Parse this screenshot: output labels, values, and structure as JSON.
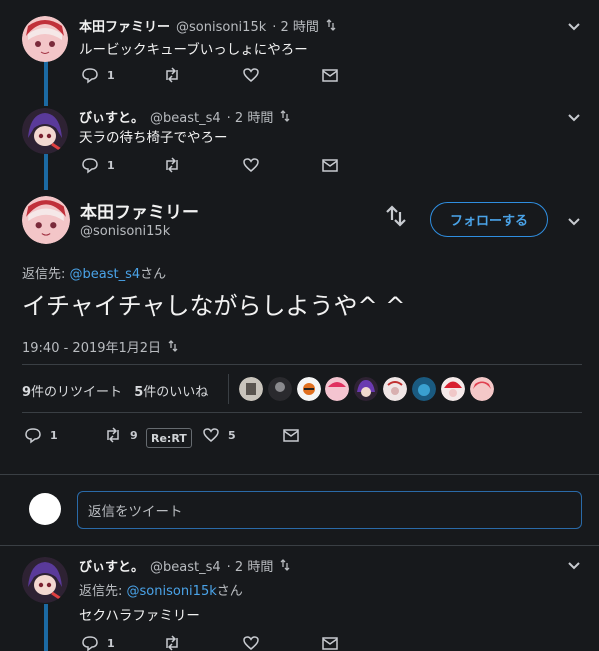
{
  "tweets": [
    {
      "name": "本田ファミリー",
      "handle": "@sonisoni15k",
      "time": "· 2 時間",
      "text": "ルービックキューブいっしょにやろー",
      "reply_count": "1",
      "avatar": "avatar-red-hair"
    },
    {
      "name": "びぃすと。",
      "handle": "@beast_s4",
      "time": "· 2 時間",
      "text": "天ラの待ち椅子でやろー",
      "reply_count": "1",
      "avatar": "avatar-purple-hair"
    }
  ],
  "main": {
    "name": "本田ファミリー",
    "handle": "@sonisoni15k",
    "follow_label": "フォローする",
    "reply_to_prefix": "返信先: ",
    "reply_to_handle": "@beast_s4",
    "reply_to_suffix": "さん",
    "text": "イチャイチャしながらしようや^ ^",
    "timestamp": "19:40 - 2019年1月2日",
    "retweets_num": "9",
    "retweets_label": "件のリツイート",
    "likes_num": "5",
    "likes_label": "件のいいね",
    "reply_count": "1",
    "retweet_count": "9",
    "rert_label": "Re:RT",
    "like_count": "5"
  },
  "reply_box": {
    "placeholder": "返信をツイート"
  },
  "bottom_tweet": {
    "name": "びぃすと。",
    "handle": "@beast_s4",
    "time": "· 2 時間",
    "reply_to_prefix": "返信先: ",
    "reply_to_handle": "@sonisoni15k",
    "reply_to_suffix": "さん",
    "text": "セクハラファミリー",
    "reply_count": "1"
  },
  "colors": {
    "background": "#17191c",
    "accent": "#4aa3e8",
    "thread_line": "#1c6aa3",
    "divider": "#3a3f44"
  }
}
